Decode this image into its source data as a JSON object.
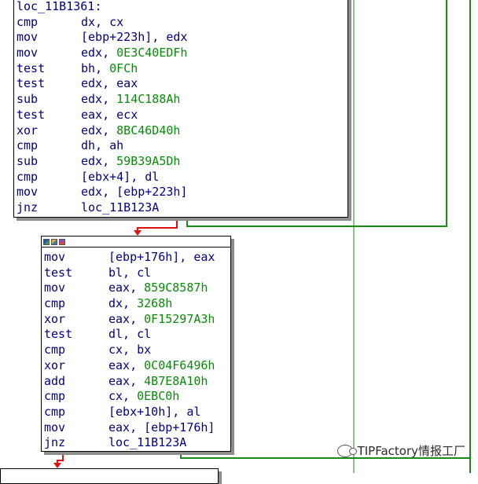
{
  "colors": {
    "true_edge": "#188c18",
    "false_edge": "#e01010",
    "text": "#000080",
    "number": "#0a8a0a"
  },
  "block1": {
    "label": "loc_11B1361:",
    "lines": [
      {
        "mn": "cmp",
        "ops": [
          {
            "t": "dx, cx",
            "c": "op"
          }
        ]
      },
      {
        "mn": "mov",
        "ops": [
          {
            "t": "[ebp+223h], edx",
            "c": "op"
          }
        ]
      },
      {
        "mn": "mov",
        "ops": [
          {
            "t": "edx, ",
            "c": "op"
          },
          {
            "t": "0E3C40EDFh",
            "c": "num"
          }
        ]
      },
      {
        "mn": "test",
        "ops": [
          {
            "t": "bh, ",
            "c": "op"
          },
          {
            "t": "0FCh",
            "c": "num"
          }
        ]
      },
      {
        "mn": "test",
        "ops": [
          {
            "t": "edx, eax",
            "c": "op"
          }
        ]
      },
      {
        "mn": "sub",
        "ops": [
          {
            "t": "edx, ",
            "c": "op"
          },
          {
            "t": "114C188Ah",
            "c": "num"
          }
        ]
      },
      {
        "mn": "test",
        "ops": [
          {
            "t": "eax, ecx",
            "c": "op"
          }
        ]
      },
      {
        "mn": "xor",
        "ops": [
          {
            "t": "edx, ",
            "c": "op"
          },
          {
            "t": "8BC46D40h",
            "c": "num"
          }
        ]
      },
      {
        "mn": "cmp",
        "ops": [
          {
            "t": "dh, ah",
            "c": "op"
          }
        ]
      },
      {
        "mn": "sub",
        "ops": [
          {
            "t": "edx, ",
            "c": "op"
          },
          {
            "t": "59B39A5Dh",
            "c": "num"
          }
        ]
      },
      {
        "mn": "cmp",
        "ops": [
          {
            "t": "[ebx+4], dl",
            "c": "op"
          }
        ]
      },
      {
        "mn": "mov",
        "ops": [
          {
            "t": "edx, [ebp+223h]",
            "c": "op"
          }
        ]
      },
      {
        "mn": "jnz",
        "ops": [
          {
            "t": "loc_11B123A",
            "c": "lbl"
          }
        ]
      }
    ]
  },
  "block2": {
    "lines": [
      {
        "mn": "mov",
        "ops": [
          {
            "t": "[ebp+176h], eax",
            "c": "op"
          }
        ]
      },
      {
        "mn": "test",
        "ops": [
          {
            "t": "bl, cl",
            "c": "op"
          }
        ]
      },
      {
        "mn": "mov",
        "ops": [
          {
            "t": "eax, ",
            "c": "op"
          },
          {
            "t": "859C8587h",
            "c": "num"
          }
        ]
      },
      {
        "mn": "cmp",
        "ops": [
          {
            "t": "dx, ",
            "c": "op"
          },
          {
            "t": "3268h",
            "c": "num"
          }
        ]
      },
      {
        "mn": "xor",
        "ops": [
          {
            "t": "eax, ",
            "c": "op"
          },
          {
            "t": "0F15297A3h",
            "c": "num"
          }
        ]
      },
      {
        "mn": "test",
        "ops": [
          {
            "t": "dl, cl",
            "c": "op"
          }
        ]
      },
      {
        "mn": "cmp",
        "ops": [
          {
            "t": "cx, bx",
            "c": "op"
          }
        ]
      },
      {
        "mn": "xor",
        "ops": [
          {
            "t": "eax, ",
            "c": "op"
          },
          {
            "t": "0C04F6496h",
            "c": "num"
          }
        ]
      },
      {
        "mn": "add",
        "ops": [
          {
            "t": "eax, ",
            "c": "op"
          },
          {
            "t": "4B7E8A10h",
            "c": "num"
          }
        ]
      },
      {
        "mn": "cmp",
        "ops": [
          {
            "t": "cx, ",
            "c": "op"
          },
          {
            "t": "0EBC0h",
            "c": "num"
          }
        ]
      },
      {
        "mn": "cmp",
        "ops": [
          {
            "t": "[ebx+10h], al",
            "c": "op"
          }
        ]
      },
      {
        "mn": "mov",
        "ops": [
          {
            "t": "eax, [ebp+176h]",
            "c": "op"
          }
        ]
      },
      {
        "mn": "jnz",
        "ops": [
          {
            "t": "loc_11B123A",
            "c": "lbl"
          }
        ]
      }
    ]
  },
  "watermark": {
    "text": "TIPFactory情报工厂",
    "icon": "wechat-icon"
  }
}
